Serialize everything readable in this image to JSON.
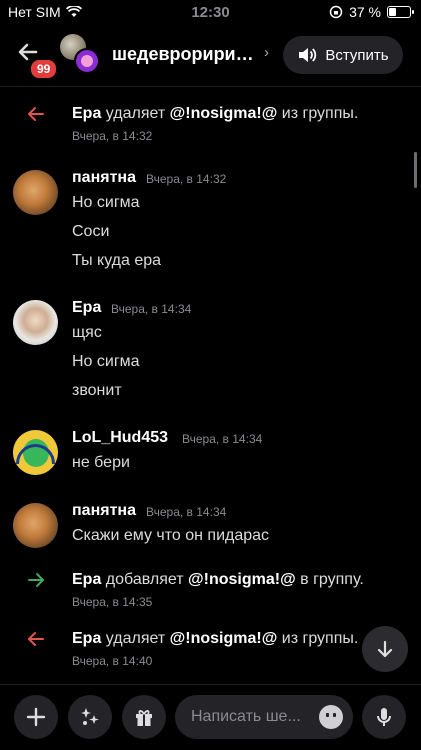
{
  "status_bar": {
    "carrier": "Нет SIM",
    "time": "12:30",
    "battery": "37 %",
    "battery_level": 0.37
  },
  "header": {
    "unread_badge": "99",
    "channel_title": "шедевроририли...",
    "chevron": "›",
    "join_label": "Вступить"
  },
  "messages": [
    {
      "type": "system",
      "icon": "remove-arrow-icon",
      "color": "#e4554e",
      "actor": "Ера",
      "action": "удаляет",
      "target": "@!nosigma!@",
      "suffix": "из группы.",
      "time": "Вчера, в 14:32"
    },
    {
      "type": "user",
      "author": "панятна",
      "time": "Вчера, в 14:32",
      "avatar": "cat-avatar",
      "lines": [
        "Но сигма",
        "Соси",
        "Ты куда ера"
      ]
    },
    {
      "type": "user",
      "author": "Ера",
      "time": "Вчера, в 14:34",
      "avatar": "face-avatar",
      "lines": [
        "щяс",
        "Но сигма",
        "звонит"
      ]
    },
    {
      "type": "user",
      "author": "LoL_Hud453",
      "time": "Вчера, в 14:34",
      "avatar": "bot-avatar",
      "lines": [
        "не бери"
      ]
    },
    {
      "type": "user",
      "author": "панятна",
      "time": "Вчера, в 14:34",
      "avatar": "cat-avatar",
      "lines": [
        "Скажи ему что он пидарас"
      ]
    },
    {
      "type": "system",
      "icon": "add-arrow-icon",
      "color": "#3fa95e",
      "actor": "Ера",
      "action": "добавляет",
      "target": "@!nosigma!@",
      "suffix": "в группу.",
      "time": "Вчера, в 14:35"
    },
    {
      "type": "system",
      "icon": "remove-arrow-icon",
      "color": "#e4554e",
      "actor": "Ера",
      "action": "удаляет",
      "target": "@!nosigma!@",
      "suffix": "из группы.",
      "time": "Вчера, в 14:40"
    }
  ],
  "composer": {
    "placeholder": "Написать ше..."
  }
}
